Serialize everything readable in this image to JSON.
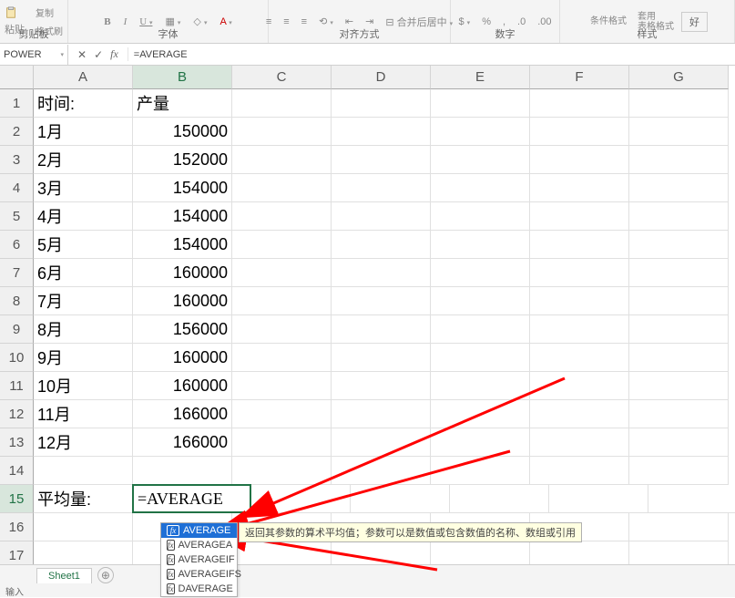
{
  "ribbon": {
    "paste_label": "粘贴",
    "format_brush": "格式刷",
    "copy_label": "复制",
    "clipboard_group": "剪贴板",
    "font_group": "字体",
    "align_group": "对齐方式",
    "merge_center": "合并后居中",
    "number_group": "数字",
    "cond_fmt": "条件格式",
    "table_fmt": "套用\n表格格式",
    "good": "好",
    "style_group": "样式"
  },
  "name_box": "POWER",
  "formula_bar": "=AVERAGE",
  "columns": [
    "A",
    "B",
    "C",
    "D",
    "E",
    "F",
    "G"
  ],
  "rows": [
    "1",
    "2",
    "3",
    "4",
    "5",
    "6",
    "7",
    "8",
    "9",
    "10",
    "11",
    "12",
    "13",
    "14",
    "15",
    "16",
    "17"
  ],
  "active_row_idx": 14,
  "active_col_idx": 1,
  "data": {
    "A1": "时间:",
    "B1": "产量",
    "A2": "1月",
    "B2": "150000",
    "A3": "2月",
    "B3": "152000",
    "A4": "3月",
    "B4": "154000",
    "A5": "4月",
    "B5": "154000",
    "A6": "5月",
    "B6": "154000",
    "A7": "6月",
    "B7": "160000",
    "A8": "7月",
    "B8": "160000",
    "A9": "8月",
    "B9": "156000",
    "A10": "9月",
    "B10": "160000",
    "A11": "10月",
    "B11": "160000",
    "A12": "11月",
    "B12": "166000",
    "A13": "12月",
    "B13": "166000",
    "A15": "平均量:"
  },
  "editing_cell_value": "=AVERAGE",
  "autocomplete": {
    "items": [
      "AVERAGE",
      "AVERAGEA",
      "AVERAGEIF",
      "AVERAGEIFS",
      "DAVERAGE"
    ],
    "selected": 0,
    "tooltip": "返回其参数的算术平均值；参数可以是数值或包含数值的名称、数组或引用"
  },
  "sheet_tab": "Sheet1",
  "status_text": "输入"
}
